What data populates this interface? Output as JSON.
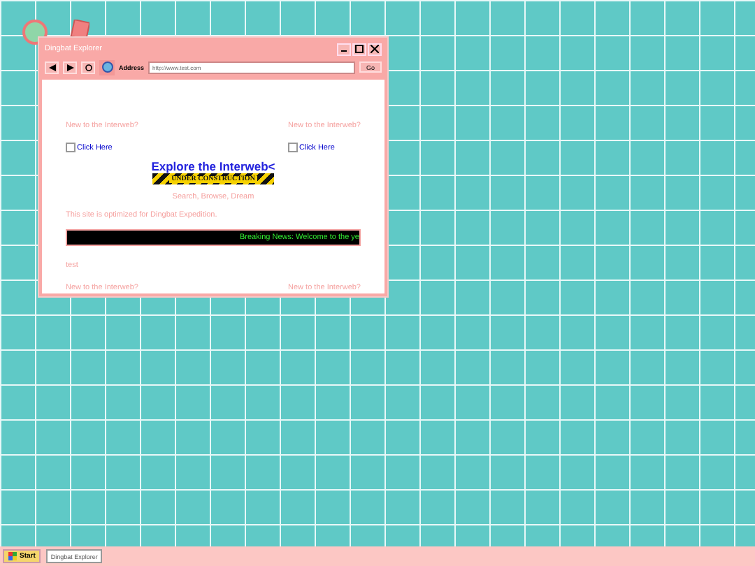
{
  "window": {
    "title": "Dingbat Explorer"
  },
  "toolbar": {
    "address_label": "Address",
    "address": "http://www.test.com",
    "go": "Go"
  },
  "page": {
    "promo_left": {
      "question": "New to the Interweb?",
      "link": "Click Here"
    },
    "promo_right": {
      "question": "New to the Interweb?",
      "link": "Click Here"
    },
    "heading": "Explore the Interweb<",
    "banner": "UNDER CONSTRUCTION",
    "tagline": "Search, Browse, Dream",
    "optimized": "This site is optimized for Dingbat Expedition.",
    "ticker": "Breaking News: Welcome to the ye",
    "test": "test",
    "bottom_left": "New to the Interweb?",
    "bottom_right": "New to the Interweb?"
  },
  "taskbar": {
    "start": "Start",
    "tasks": [
      {
        "label": "Dingbat Explorer",
        "selected": true
      }
    ]
  }
}
